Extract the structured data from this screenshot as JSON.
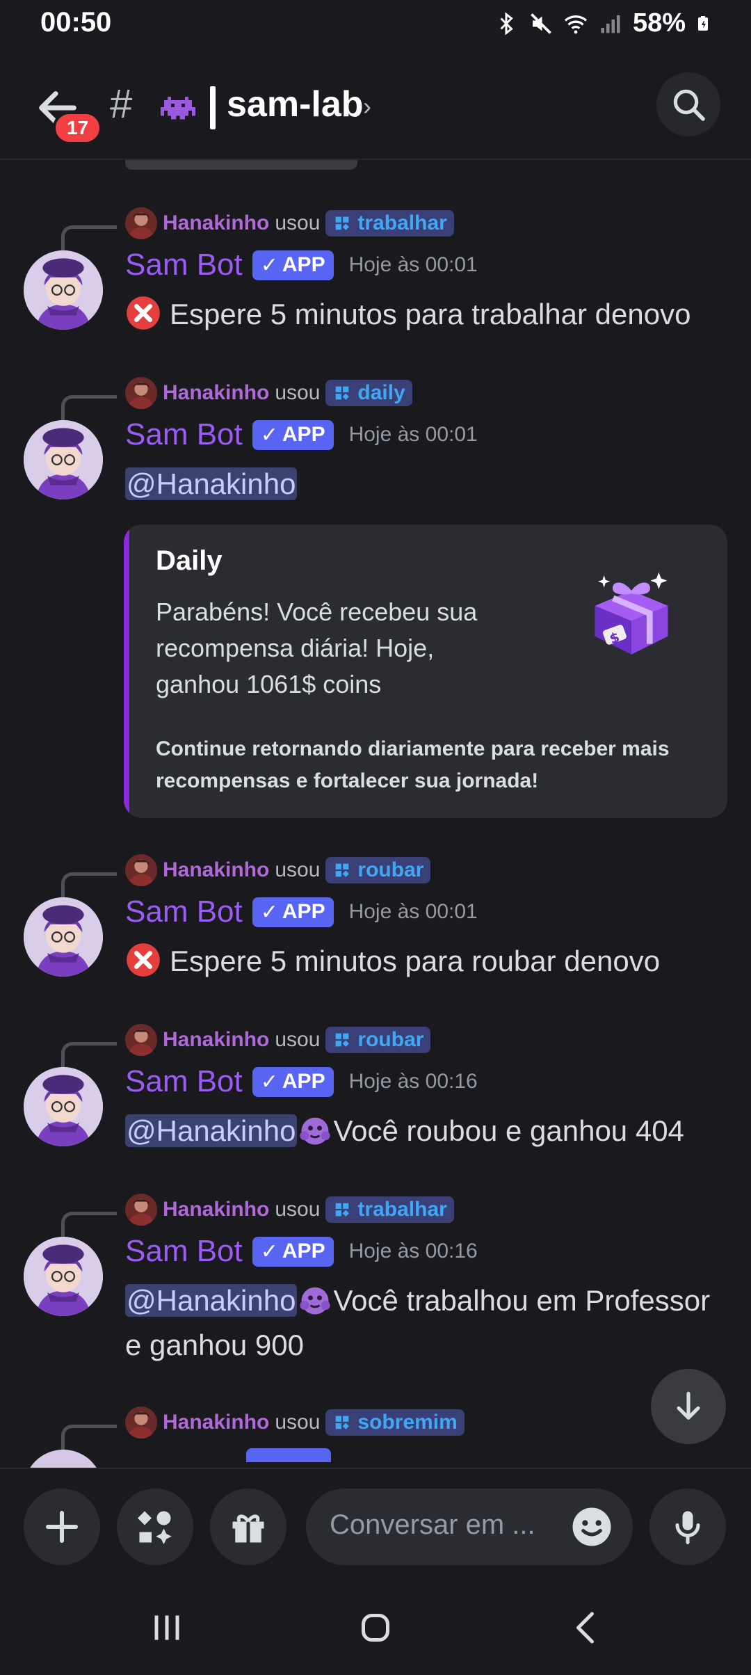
{
  "status_bar": {
    "time": "00:50",
    "battery": "58%"
  },
  "header": {
    "unread_count": "17",
    "hash": "#",
    "channel_name": "sam-lab"
  },
  "messages": [
    {
      "reply_user": "Hanakinho",
      "reply_used": "usou",
      "command": "trabalhar",
      "bot_name": "Sam Bot",
      "app_tag": "APP",
      "timestamp": "Hoje às 00:01",
      "text": "Espere 5 minutos para trabalhar denovo"
    },
    {
      "reply_user": "Hanakinho",
      "reply_used": "usou",
      "command": "daily",
      "bot_name": "Sam Bot",
      "app_tag": "APP",
      "timestamp": "Hoje às 00:01",
      "mention": "@Hanakinho",
      "embed": {
        "title": "Daily",
        "description": "Parabéns! Você recebeu sua recompensa diária! Hoje, ganhou 1061$ coins",
        "footer": "Continue retornando diariamente para receber mais recompensas e fortalecer sua jornada!"
      }
    },
    {
      "reply_user": "Hanakinho",
      "reply_used": "usou",
      "command": "roubar",
      "bot_name": "Sam Bot",
      "app_tag": "APP",
      "timestamp": "Hoje às 00:01",
      "text": "Espere 5 minutos para roubar denovo"
    },
    {
      "reply_user": "Hanakinho",
      "reply_used": "usou",
      "command": "roubar",
      "bot_name": "Sam Bot",
      "app_tag": "APP",
      "timestamp": "Hoje às 00:16",
      "mention": "@Hanakinho",
      "text": "Você roubou e ganhou 404"
    },
    {
      "reply_user": "Hanakinho",
      "reply_used": "usou",
      "command": "trabalhar",
      "bot_name": "Sam Bot",
      "app_tag": "APP",
      "timestamp": "Hoje às 00:16",
      "mention": "@Hanakinho",
      "text": "Você trabalhou em Professor e ganhou 900"
    },
    {
      "reply_user": "Hanakinho",
      "reply_used": "usou",
      "command": "sobremim"
    }
  ],
  "composer": {
    "placeholder": "Conversar em ..."
  },
  "colors": {
    "accent": "#5865f2",
    "bot_name": "#9b5cf5",
    "mention_bg": "#3c4270",
    "embed_stripe": "#8a2be2"
  }
}
